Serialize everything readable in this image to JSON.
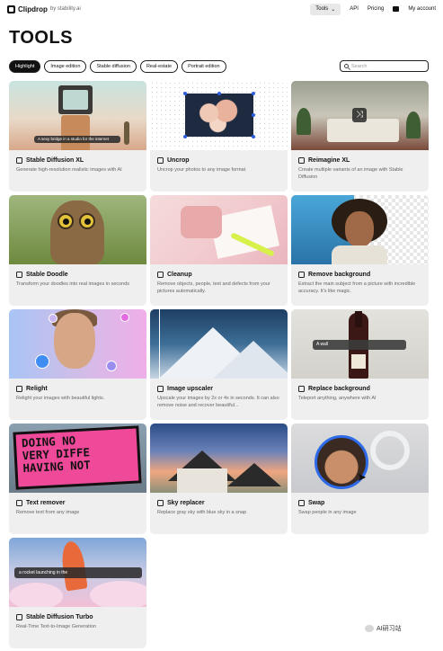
{
  "header": {
    "logo_name": "Clipdrop",
    "logo_suffix": "by stability.ai",
    "nav": {
      "tools_label": "Tools",
      "api_label": "API",
      "pricing_label": "Pricing",
      "account_label": "My account"
    }
  },
  "page_title": "TOOLS",
  "filters": [
    "Highlight",
    "Image edition",
    "Stable diffusion",
    "Real-estate",
    "Portrait edition"
  ],
  "active_filter": "Highlight",
  "search": {
    "placeholder": "Search"
  },
  "cards": [
    {
      "title": "Stable Diffusion XL",
      "desc": "Generate high-resolution realistic images with AI",
      "icon": "image-icon",
      "overlay": "A sexy bridge in a studio for the internet"
    },
    {
      "title": "Uncrop",
      "desc": "Uncrop your photos to any image format",
      "icon": "crop-icon"
    },
    {
      "title": "Reimagine XL",
      "desc": "Create multiple variants of an image with Stable Diffusion",
      "icon": "image-icon"
    },
    {
      "title": "Stable Doodle",
      "desc": "Transform your doodles into real images in seconds",
      "icon": "magic-wand-icon"
    },
    {
      "title": "Cleanup",
      "desc": "Remove objects, people, text and defects from your pictures automatically.",
      "icon": "eraser-icon"
    },
    {
      "title": "Remove background",
      "desc": "Extract the main subject from a picture with incredible accuracy. It's like magic.",
      "icon": "cutout-icon"
    },
    {
      "title": "Relight",
      "desc": "Relight your images with beautiful lights.",
      "icon": "sun-icon"
    },
    {
      "title": "Image upscaler",
      "desc": "Upscale your images by 2x or 4x in seconds. It can also remove noise and recover beautiful...",
      "icon": "upscale-icon"
    },
    {
      "title": "Replace background",
      "desc": "Teleport anything, anywhere with AI",
      "icon": "replace-icon",
      "overlay": "A wall"
    },
    {
      "title": "Text remover",
      "desc": "Remove text from any image",
      "icon": "text-remove-icon",
      "overlay_lines": [
        "DOING NO",
        "VERY DIFFE",
        "HAVING NOT"
      ]
    },
    {
      "title": "Sky replacer",
      "desc": "Replace gray sky with blue sky in a snap",
      "icon": "sky-icon"
    },
    {
      "title": "Swap",
      "desc": "Swap people in any image",
      "icon": "swap-icon"
    },
    {
      "title": "Stable Diffusion Turbo",
      "desc": "Real-Time Text-to-Image Generation",
      "icon": "image-icon",
      "overlay": "a rocket launching in the"
    }
  ],
  "watermark": "AI研习站"
}
